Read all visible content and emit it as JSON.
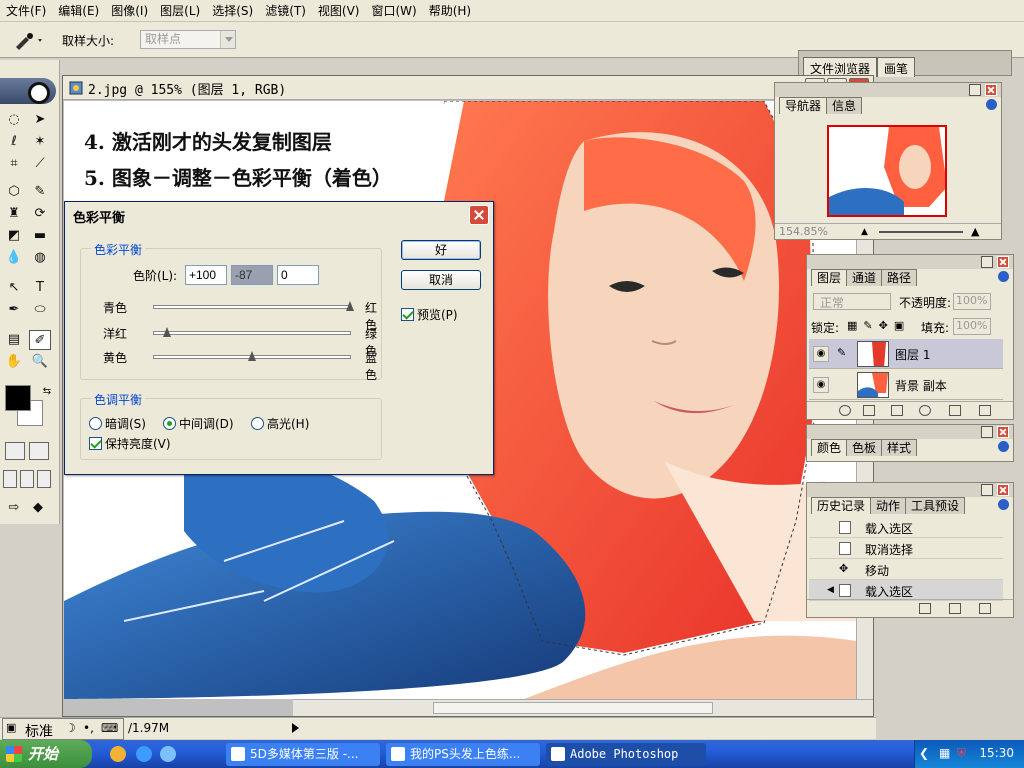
{
  "menu": [
    "文件(F)",
    "编辑(E)",
    "图像(I)",
    "图层(L)",
    "选择(S)",
    "滤镜(T)",
    "视图(V)",
    "窗口(W)",
    "帮助(H)"
  ],
  "options_bar": {
    "sample_size_label": "取样大小:",
    "sample_size_value": "取样点",
    "palette_well_tabs": [
      "文件浏览器",
      "画笔"
    ]
  },
  "document": {
    "title": "2.jpg @ 155% (图层 1, RGB)",
    "overlay_lines": [
      "4. 激活刚才的头发复制图层",
      "5. 图象－调整－色彩平衡（着色）"
    ]
  },
  "color_balance": {
    "title": "色彩平衡",
    "group_label": "色彩平衡",
    "levels_label": "色阶(L):",
    "levels": [
      "+100",
      "-87",
      "0"
    ],
    "sliders": [
      {
        "left": "青色",
        "right": "红色",
        "value": 100
      },
      {
        "left": "洋红",
        "right": "绿色",
        "value": -87
      },
      {
        "left": "黄色",
        "right": "蓝色",
        "value": 0
      }
    ],
    "tone_label": "色调平衡",
    "tones": [
      "暗调(S)",
      "中间调(D)",
      "高光(H)"
    ],
    "tone_selected": "中间调(D)",
    "preserve_luminosity": "保持亮度(V)",
    "ok": "好",
    "cancel": "取消",
    "preview": "预览(P)"
  },
  "navigator": {
    "tabs": [
      "导航器",
      "信息"
    ],
    "zoom": "154.85%"
  },
  "layers": {
    "tabs": [
      "图层",
      "通道",
      "路径"
    ],
    "blend_mode": "正常",
    "opacity_label": "不透明度:",
    "opacity": "100%",
    "lock_label": "锁定:",
    "fill_label": "填充:",
    "fill": "100%",
    "items": [
      "图层 1",
      "背景 副本"
    ]
  },
  "color_palette": {
    "tabs": [
      "颜色",
      "色板",
      "样式"
    ]
  },
  "history": {
    "tabs": [
      "历史记录",
      "动作",
      "工具预设"
    ],
    "items": [
      "载入选区",
      "取消选择",
      "移动",
      "载入选区"
    ]
  },
  "status": {
    "ime_label": "标准",
    "doc_size": "/1.97M"
  },
  "taskbar": {
    "start": "开始",
    "tasks": [
      "5D多媒体第三版 -...",
      "我的PS头发上色练...",
      "Adobe Photoshop"
    ],
    "clock": "15:30"
  }
}
